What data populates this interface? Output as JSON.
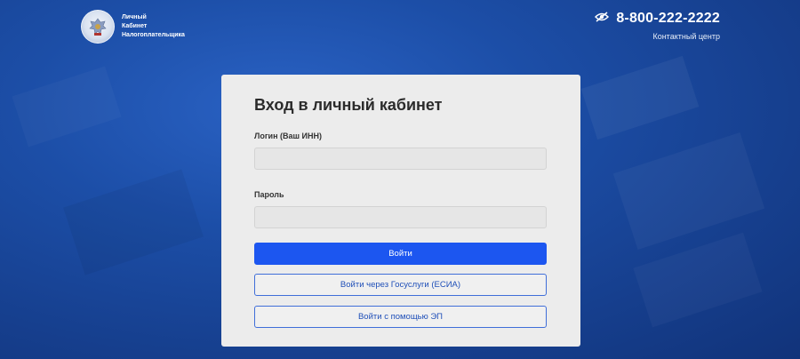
{
  "header": {
    "logo_lines": [
      "Личный",
      "Кабинет",
      "Налогоплательщика"
    ],
    "phone": "8-800-222-2222",
    "contact_label": "Контактный центр",
    "phone_icon": "hearing-impaired-icon"
  },
  "login_form": {
    "title": "Вход в личный кабинет",
    "login_label": "Логин (Ваш ИНН)",
    "login_value": "",
    "password_label": "Пароль",
    "password_value": "",
    "submit_label": "Войти",
    "gosuslugi_label": "Войти через Госуслуги (ЕСИА)",
    "ep_label": "Войти с помощью ЭП"
  },
  "colors": {
    "background": "#1c4ea7",
    "primary_button": "#1c56f0",
    "outline_button_border": "#3f6ed9",
    "card": "#ececec"
  }
}
